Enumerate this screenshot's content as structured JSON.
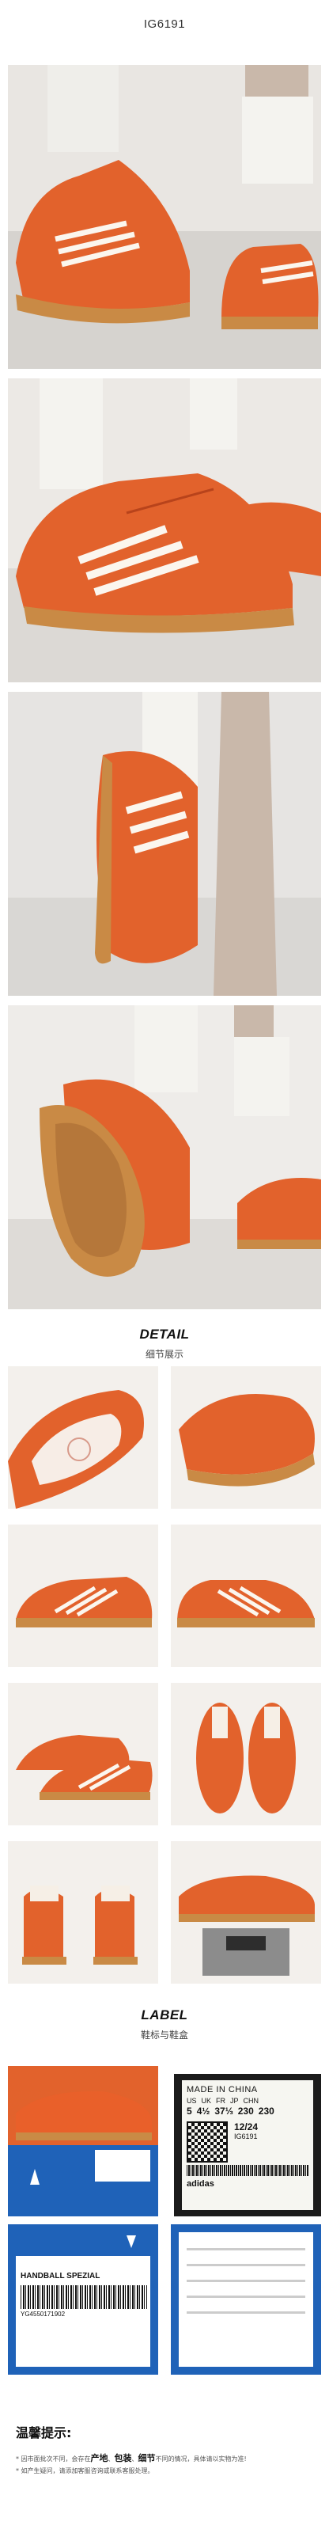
{
  "title": "IG6191",
  "detail_section": {
    "en": "DETAIL",
    "cn": "细节展示"
  },
  "label_section": {
    "en": "LABEL",
    "cn": "鞋标与鞋盒"
  },
  "shoe_label": {
    "made_in": "MADE IN CHINA",
    "size_headers": [
      "US",
      "UK",
      "FR",
      "JP",
      "CHN"
    ],
    "size_values": [
      "5",
      "4½",
      "37⅓",
      "230",
      "230"
    ],
    "date": "12/24",
    "article": "IG6191",
    "brand": "adidas"
  },
  "box_label": {
    "product": "HANDBALL SPEZIAL",
    "barcode_number": "YG4550171902"
  },
  "notes": {
    "heading": "温馨提示:",
    "line1_prefix": "* 因市面批次不同，会存在",
    "line1_em1": "产地",
    "line1_sep1": "、",
    "line1_em2": "包装",
    "line1_sep2": "、",
    "line1_em3": "细节",
    "line1_suffix": "不同的情况，具体请以实物为准!",
    "line2": "* 如产生疑问，请添加客服咨询或联系客服处理。"
  },
  "colors": {
    "shoe_orange": "#e2622c",
    "gum_sole": "#c98a45",
    "floor": "#d9d6d2",
    "sock": "#f4f3ef",
    "leg": "#c9b8aa"
  }
}
